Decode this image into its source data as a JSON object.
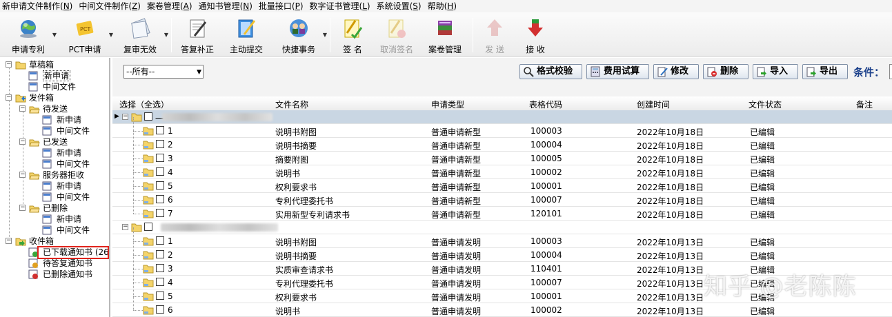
{
  "menu": [
    {
      "label": "新申请文件制作(",
      "key": "N",
      "tail": ")"
    },
    {
      "label": "中间文件制作(",
      "key": "Z",
      "tail": ")"
    },
    {
      "label": "案卷管理(",
      "key": "A",
      "tail": ")"
    },
    {
      "label": "通知书管理(",
      "key": "N",
      "tail": ")"
    },
    {
      "label": "批量接口(",
      "key": "P",
      "tail": ")"
    },
    {
      "label": "数字证书管理(",
      "key": "L",
      "tail": ")"
    },
    {
      "label": "系统设置(",
      "key": "S",
      "tail": ")"
    },
    {
      "label": "帮助(",
      "key": "H",
      "tail": ")"
    }
  ],
  "toolbar": {
    "apply_patent": "申请专利",
    "pct_apply": "PCT申请",
    "review_invalid": "复审无效",
    "reply_correction": "答复补正",
    "active_submit": "主动提交",
    "quick_affairs": "快捷事务",
    "sign": "签 名",
    "cancel_sign": "取消签名",
    "case_management": "案卷管理",
    "send": "发 送",
    "receive": "接 收"
  },
  "tree": {
    "draft_box": "草稿箱",
    "draft_new": "新申请",
    "draft_mid": "中间文件",
    "outbox": "发件箱",
    "pending_send": "待发送",
    "pending_new": "新申请",
    "pending_mid": "中间文件",
    "sent": "已发送",
    "sent_new": "新申请",
    "sent_mid": "中间文件",
    "server_rejected": "服务器拒收",
    "rejected_new": "新申请",
    "rejected_mid": "中间文件",
    "deleted": "已删除",
    "deleted_new": "新申请",
    "deleted_mid": "中间文件",
    "inbox": "收件箱",
    "downloaded_notices": "已下载通知书 (26",
    "pending_reply_notices": "待答复通知书",
    "deleted_notices": "已删除通知书"
  },
  "actions": {
    "filter_value": "--所有--",
    "format_check": "格式校验",
    "fee_trial": "费用试算",
    "modify": "修改",
    "delete": "删除",
    "import": "导入",
    "export": "导出",
    "condition": "条件："
  },
  "grid": {
    "headers": {
      "select": "选择（全选）",
      "file_name": "文件名称",
      "apply_type": "申请类型",
      "form_code": "表格代码",
      "created": "创建时间",
      "status": "文件状态",
      "note": "备注"
    },
    "groups": [
      {
        "label": "一",
        "rows": [
          {
            "no": "1",
            "name": "说明书附图",
            "type": "普通申请新型",
            "code": "100003",
            "created": "2022年10月18日",
            "status": "已编辑"
          },
          {
            "no": "2",
            "name": "说明书摘要",
            "type": "普通申请新型",
            "code": "100004",
            "created": "2022年10月18日",
            "status": "已编辑"
          },
          {
            "no": "3",
            "name": "摘要附图",
            "type": "普通申请新型",
            "code": "100005",
            "created": "2022年10月18日",
            "status": "已编辑"
          },
          {
            "no": "4",
            "name": "说明书",
            "type": "普通申请新型",
            "code": "100002",
            "created": "2022年10月18日",
            "status": "已编辑"
          },
          {
            "no": "5",
            "name": "权利要求书",
            "type": "普通申请新型",
            "code": "100001",
            "created": "2022年10月18日",
            "status": "已编辑"
          },
          {
            "no": "6",
            "name": "专利代理委托书",
            "type": "普通申请新型",
            "code": "100007",
            "created": "2022年10月18日",
            "status": "已编辑"
          },
          {
            "no": "7",
            "name": "实用新型专利请求书",
            "type": "普通申请新型",
            "code": "120101",
            "created": "2022年10月18日",
            "status": "已编辑"
          }
        ]
      },
      {
        "label": "",
        "rows": [
          {
            "no": "1",
            "name": "说明书附图",
            "type": "普通申请发明",
            "code": "100003",
            "created": "2022年10月13日",
            "status": "已编辑"
          },
          {
            "no": "2",
            "name": "说明书摘要",
            "type": "普通申请发明",
            "code": "100004",
            "created": "2022年10月13日",
            "status": "已编辑"
          },
          {
            "no": "3",
            "name": "实质审查请求书",
            "type": "普通申请发明",
            "code": "110401",
            "created": "2022年10月13日",
            "status": "已编辑"
          },
          {
            "no": "4",
            "name": "专利代理委托书",
            "type": "普通申请发明",
            "code": "100007",
            "created": "2022年10月13日",
            "status": "已编辑"
          },
          {
            "no": "5",
            "name": "权利要求书",
            "type": "普通申请发明",
            "code": "100001",
            "created": "2022年10月13日",
            "status": "已编辑"
          },
          {
            "no": "6",
            "name": "说明书",
            "type": "普通申请发明",
            "code": "100002",
            "created": "2022年10月13日",
            "status": "已编辑"
          }
        ]
      }
    ]
  },
  "watermark": "知乎 @老陈陈",
  "colors": {
    "highlight_border": "#e0231c",
    "current_row": "#c9d6e3",
    "condition_text": "#1a3f8a"
  }
}
